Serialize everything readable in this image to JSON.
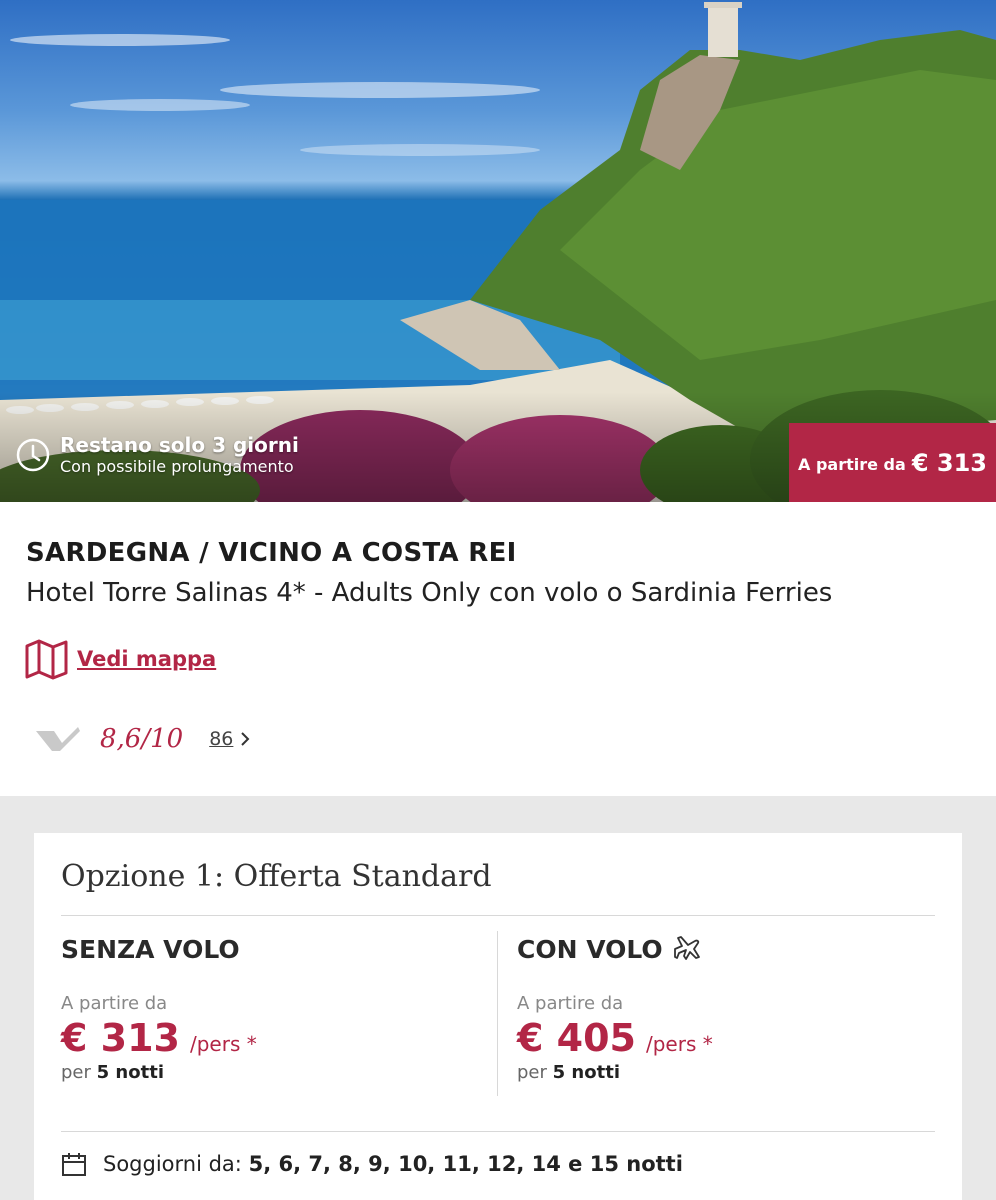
{
  "hero": {
    "countdown_main": "Restano solo 3 giorni",
    "countdown_sub": "Con possibile prolungamento",
    "price_label": "A partire da",
    "price_value": "€ 313"
  },
  "info": {
    "region": "SARDEGNA / VICINO A COSTA REI",
    "hotel_name": "Hotel Torre Salinas 4* - Adults Only con volo o Sardinia Ferries",
    "map_link": "Vedi mappa",
    "rating_score": "8,6/10",
    "rating_count": "86"
  },
  "offer": {
    "title": "Opzione 1: Offerta Standard",
    "without_flight": {
      "heading": "SENZA VOLO",
      "from_label": "A partire da",
      "price": "€ 313",
      "per_pers": "/pers *",
      "per_label": "per",
      "nights": "5 notti"
    },
    "with_flight": {
      "heading": "CON VOLO",
      "from_label": "A partire da",
      "price": "€ 405",
      "per_pers": "/pers *",
      "per_label": "per",
      "nights": "5 notti"
    },
    "stays_label": "Soggiorni da:",
    "stays_value": "5, 6, 7, 8, 9, 10, 11, 12, 14 e 15 notti"
  },
  "colors": {
    "accent": "#b22646",
    "background_gray": "#e8e8e8"
  },
  "icons": [
    "clock-icon",
    "map-icon",
    "rating-logo-icon",
    "chevron-right-icon",
    "plane-icon",
    "calendar-icon"
  ]
}
